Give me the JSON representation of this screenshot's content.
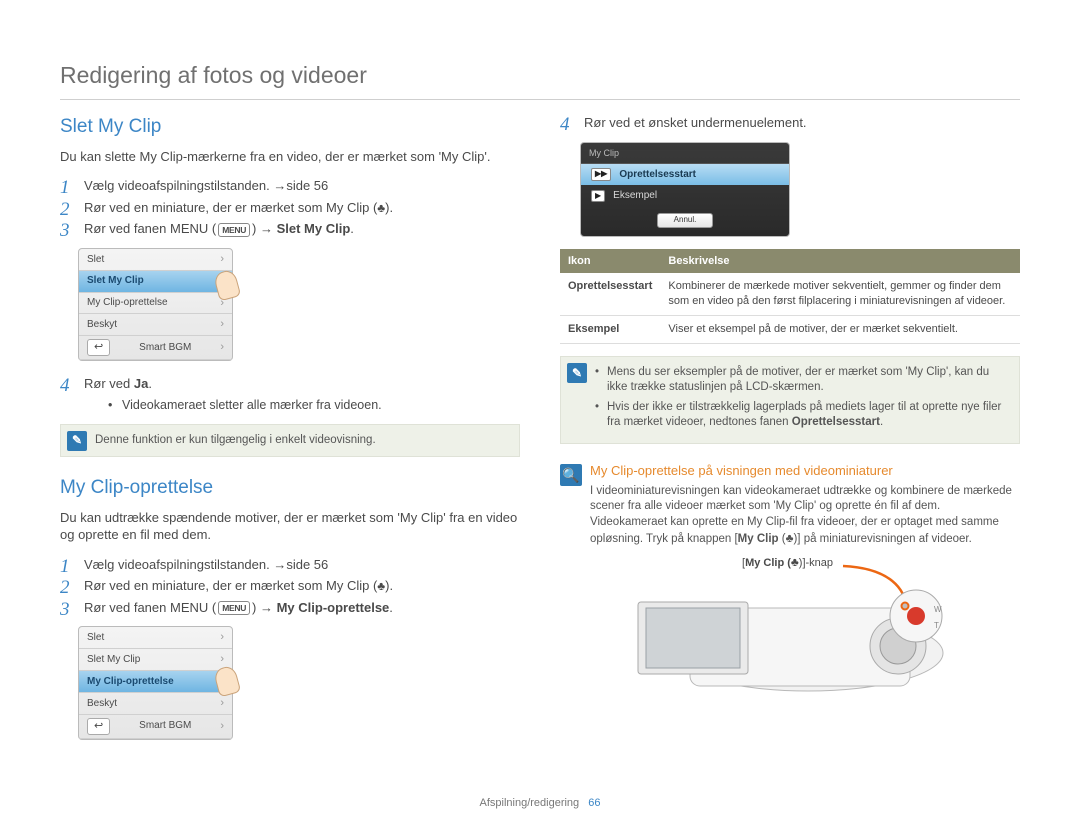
{
  "page": {
    "title": "Redigering af fotos og videoer",
    "footer_section": "Afspilning/redigering",
    "footer_page": "66"
  },
  "left": {
    "section1": {
      "title": "Slet My Clip",
      "intro": "Du kan slette My Clip-mærkerne fra en video, der er mærket som 'My Clip'.",
      "steps": {
        "s1": "Vælg videoafspilningstilstanden. →side 56",
        "s2_a": "Rør ved en miniature, der er mærket som My Clip (",
        "s2_b": ").",
        "s3_a": "Rør ved fanen MENU (",
        "s3_b": ") → ",
        "s3_bold": "Slet My Clip",
        "s3_c": ".",
        "s4_a": "Rør ved ",
        "s4_bold": "Ja",
        "s4_c": ".",
        "s4_sub": "Videokameraet sletter alle mærker fra videoen."
      },
      "menu_items": [
        "Slet",
        "Slet My Clip",
        "My Clip-oprettelse",
        "Beskyt",
        "Smart BGM"
      ],
      "back_glyph": "↩",
      "chip_menu": "MENU",
      "note_icon": "✎",
      "note_text": "Denne funktion er kun tilgængelig i enkelt videovisning."
    },
    "section2": {
      "title": "My Clip-oprettelse",
      "intro": "Du kan udtrække spændende motiver, der er mærket som 'My Clip' fra en video og oprette en fil med dem.",
      "steps": {
        "s1": "Vælg videoafspilningstilstanden. →side 56",
        "s2_a": "Rør ved en miniature, der er mærket som My Clip (",
        "s2_b": ").",
        "s3_a": "Rør ved fanen MENU (",
        "s3_b": ") → ",
        "s3_bold": "My Clip-oprettelse",
        "s3_c": "."
      },
      "menu_items": [
        "Slet",
        "Slet My Clip",
        "My Clip-oprettelse",
        "Beskyt",
        "Smart BGM"
      ],
      "back_glyph": "↩"
    }
  },
  "right": {
    "step4": "Rør ved et ønsket undermenuelement.",
    "sub": {
      "header": "My Clip",
      "row1": "Oprettelsesstart",
      "row1_icon": "▶▶",
      "row2": "Eksempel",
      "row2_icon": "▶",
      "cancel": "Annul."
    },
    "table": {
      "h1": "Ikon",
      "h2": "Beskrivelse",
      "r1_icon": "Oprettelsesstart",
      "r1_desc": "Kombinerer de mærkede motiver sekventielt, gemmer og finder dem som en video på den først filplacering i miniaturevisningen af videoer.",
      "r2_icon": "Eksempel",
      "r2_desc": "Viser et eksempel på de motiver, der er mærket sekventielt."
    },
    "note": {
      "icon": "✎",
      "b1": "Mens du ser eksempler på de motiver, der er mærket som 'My Clip', kan du ikke trække statuslinjen på LCD-skærmen.",
      "b2_a": "Hvis der ikke er tilstrækkelig lagerplads på mediets lager til at oprette nye filer fra mærket videoer, nedtones fanen ",
      "b2_bold": "Oprettelsesstart",
      "b2_b": "."
    },
    "tip": {
      "icon_glyph": "🔍",
      "title": "My Clip-oprettelse på visningen med videominiaturer",
      "body_a": "I videominiaturevisningen kan videokameraet udtrække og kombinere de mærkede scener fra alle videoer mærket som 'My Clip' og oprette én fil af dem. Videokameraet kan oprette en My Clip-fil fra videoer, der er optaget med samme opløsning. Tryk på knappen [",
      "body_bold": "My Clip",
      "body_heart": "♣",
      "body_b": ")] på miniaturevisningen af videoer.",
      "callout_a": "My Clip (",
      "callout_b": ")]-knap"
    }
  }
}
